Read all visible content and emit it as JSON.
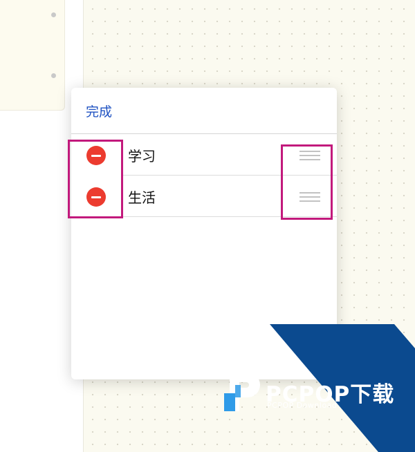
{
  "popover": {
    "done_label": "完成",
    "items": [
      {
        "label": "学习"
      },
      {
        "label": "生活"
      }
    ]
  },
  "watermark": {
    "title": "PCPOP下载",
    "subtitle": "PCPOP Download"
  },
  "colors": {
    "done_text": "#1f52c2",
    "delete_button": "#ec3b2f",
    "annotation": "#c2197c",
    "watermark_band": "#0b4a8f",
    "canvas": "#fbfaf0"
  },
  "icons": {
    "delete": "minus-circle-icon",
    "reorder": "drag-handle-icon",
    "logo": "pcpop-logo-icon"
  }
}
